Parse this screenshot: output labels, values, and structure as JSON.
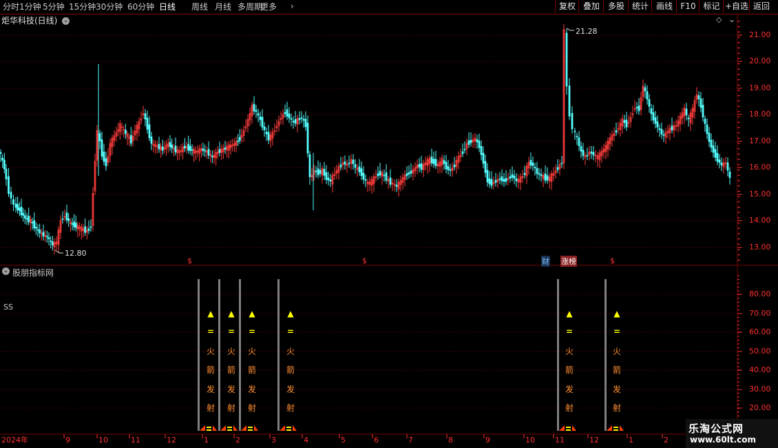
{
  "toolbar": {
    "periods": [
      "分时",
      "1分钟",
      "5分钟",
      "15分钟",
      "30分钟",
      "60分钟",
      "日线",
      "周线",
      "月线",
      "多周期",
      "更多"
    ],
    "active_period": "日线",
    "buttons": [
      "复权",
      "叠加",
      "多股",
      "统计",
      "画线",
      "F10",
      "标记",
      "+自选",
      "返回"
    ]
  },
  "chart": {
    "title": "炬华科技(日线)",
    "price_labels": [
      "21.00",
      "20.00",
      "19.00",
      "18.00",
      "17.00",
      "16.00",
      "15.00",
      "14.00",
      "13.00"
    ],
    "high_annotation": "21.28",
    "low_annotation": "12.80",
    "markers": [
      {
        "text": "$",
        "color": "#ff3030"
      },
      {
        "text": "$",
        "color": "#ff3030"
      },
      {
        "text": "财",
        "color": "#80c8ff"
      },
      {
        "text": "涨榜",
        "color": "#ffffff"
      },
      {
        "text": "$",
        "color": "#ff3030"
      }
    ]
  },
  "indicator": {
    "title": "股朋指标网",
    "series_label": "SS",
    "value_labels": [
      "80.00",
      "70.00",
      "60.00",
      "50.00",
      "40.00",
      "30.00",
      "20.00"
    ],
    "signal_chars": [
      "▲",
      "=",
      "火",
      "箭",
      "发",
      "射"
    ],
    "signal_colors": {
      "arrow": "#ffff00",
      "equal": "#ffff00",
      "text": "#ff9030",
      "bar": "#808080",
      "base": "#ff4000"
    }
  },
  "date_axis": [
    "2024年",
    "9",
    "10",
    "11",
    "12",
    "1",
    "2",
    "3",
    "4",
    "5",
    "6",
    "7",
    "8",
    "9",
    "10",
    "11",
    "12",
    "1",
    "2"
  ],
  "watermark": {
    "line1": "乐淘公式网",
    "line2": "www.60lt.com"
  },
  "colors": {
    "up": "#ff3c3c",
    "down": "#54ffff",
    "grid": "#7a0000",
    "axis": "#ff3030"
  }
}
